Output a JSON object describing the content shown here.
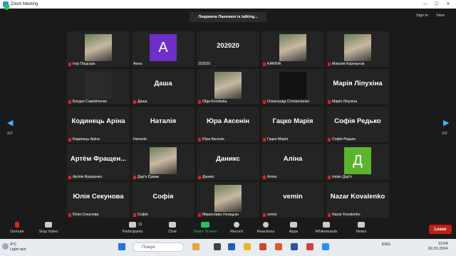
{
  "window": {
    "title": "Zoom Meeting",
    "minimize": "—",
    "maximize": "☐",
    "close": "✕"
  },
  "header": {
    "talking": "Людмила Лановюк is talking...",
    "sign_in": "Sign in",
    "view": "View"
  },
  "pagination": {
    "left": "2/2",
    "right": "2/2"
  },
  "participants": [
    {
      "name": "Ігор Пацьора",
      "big": "",
      "muted": true,
      "pic": "photo"
    },
    {
      "name": "Анна",
      "big": "",
      "muted": false,
      "initial": "A",
      "bg": "#6e2fc8"
    },
    {
      "name": "202020",
      "big": "202020",
      "muted": false
    },
    {
      "name": "KARINA",
      "big": "",
      "muted": true,
      "pic": "photo"
    },
    {
      "name": "Максим Карнаухов",
      "big": "",
      "muted": true,
      "pic": "photo"
    },
    {
      "name": "Богдан Самойленко",
      "big": "",
      "muted": true,
      "pic": "logo"
    },
    {
      "name": "Даша",
      "big": "Даша",
      "muted": true
    },
    {
      "name": "Olga Korobska",
      "big": "",
      "muted": true,
      "pic": "photo"
    },
    {
      "name": "Олександр Степанченко",
      "big": "",
      "muted": true,
      "pic": "dark"
    },
    {
      "name": "Марія Ліпухіна",
      "big": "Марія Ліпухіна",
      "muted": true
    },
    {
      "name": "Кодинець Аріна",
      "big": "Кодинець Аріна",
      "muted": true
    },
    {
      "name": "Наталія",
      "big": "Наталія",
      "muted": false
    },
    {
      "name": "Юра Аксенін",
      "big": "Юра Аксенін",
      "muted": true
    },
    {
      "name": "Гацко Марія",
      "big": "Гацко Марія",
      "muted": true
    },
    {
      "name": "Софія Редько",
      "big": "Софія Редько",
      "muted": true
    },
    {
      "name": "Артём Фращенко",
      "big": "Артём Фращен...",
      "muted": true
    },
    {
      "name": "Дар'я Єрмак",
      "big": "",
      "muted": true,
      "pic": "photo"
    },
    {
      "name": "Даникс",
      "big": "Даникс",
      "muted": true
    },
    {
      "name": "Аліна",
      "big": "Аліна",
      "muted": true
    },
    {
      "name": "Наїко Дар'я",
      "big": "",
      "muted": true,
      "initial": "Д",
      "bg": "#5cb52c"
    },
    {
      "name": "Юлія Секунова",
      "big": "Юлія Секунова",
      "muted": true
    },
    {
      "name": "Софія",
      "big": "Софія",
      "muted": true
    },
    {
      "name": "Мирослава Ухницька",
      "big": "",
      "muted": true,
      "pic": "photo"
    },
    {
      "name": "vemin",
      "big": "vemin",
      "muted": true
    },
    {
      "name": "Nazar Kovalenko",
      "big": "Nazar Kovalenko",
      "muted": true
    }
  ],
  "toolbar": {
    "unmute": "Unmute",
    "stop_video": "Stop Video",
    "participants": "Participants",
    "participants_count": "31",
    "chat": "Chat",
    "share_screen": "Share Screen",
    "record": "Record",
    "reactions": "Reactions",
    "apps": "Apps",
    "whiteboards": "Whiteboards",
    "notes": "Notes",
    "leave": "Leave",
    "share_color": "#23c55e"
  },
  "taskbar": {
    "temp": "4°C",
    "weather": "Light rain",
    "search_placeholder": "Пошук",
    "lang": "ENG",
    "time": "12:04",
    "date": "02.01.2024"
  }
}
